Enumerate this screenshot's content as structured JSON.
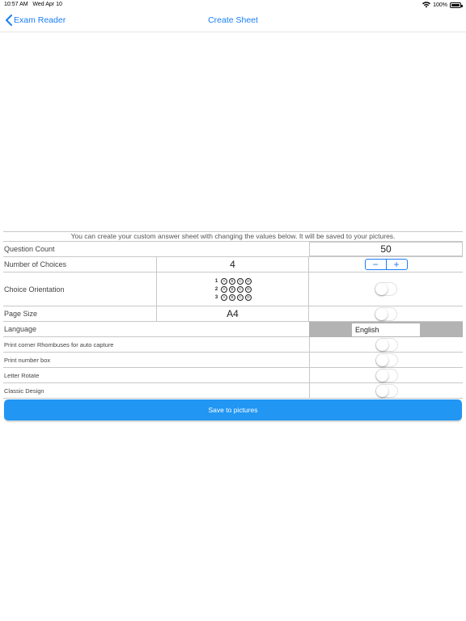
{
  "status": {
    "time": "10:57 AM",
    "date": "Wed Apr 10",
    "battery": "100%",
    "icons": [
      "wifi-icon",
      "battery-icon"
    ]
  },
  "nav": {
    "back_label": "Exam Reader",
    "title": "Create Sheet"
  },
  "form": {
    "info": "You can create your custom answer sheet with changing the values below. It will be saved to your pictures.",
    "question_count": {
      "label": "Question Count",
      "value": "50"
    },
    "choices": {
      "label": "Number of Choices",
      "value": "4",
      "minus": "−",
      "plus": "+"
    },
    "orientation": {
      "label": "Choice Orientation",
      "rows": [
        {
          "num": "1",
          "bubbles": [
            "A",
            "B",
            "C",
            "D"
          ]
        },
        {
          "num": "2",
          "bubbles": [
            "A",
            "B",
            "C",
            "D"
          ]
        },
        {
          "num": "3",
          "bubbles": [
            "A",
            "B",
            "C",
            "D"
          ]
        }
      ]
    },
    "page_size": {
      "label": "Page Size",
      "value": "A4"
    },
    "language": {
      "label": "Language",
      "value": "English"
    },
    "print_corner": {
      "label": "Print corner Rhombuses for auto capture"
    },
    "print_number": {
      "label": "Print number box"
    },
    "letter_rotate": {
      "label": "Letter Rotate"
    },
    "classic_design": {
      "label": "Classic Design"
    }
  },
  "save_label": "Save to pictures",
  "colors": {
    "accent": "#1a7ef5",
    "button": "#2196f3",
    "language_bg": "#b3b3b3"
  }
}
